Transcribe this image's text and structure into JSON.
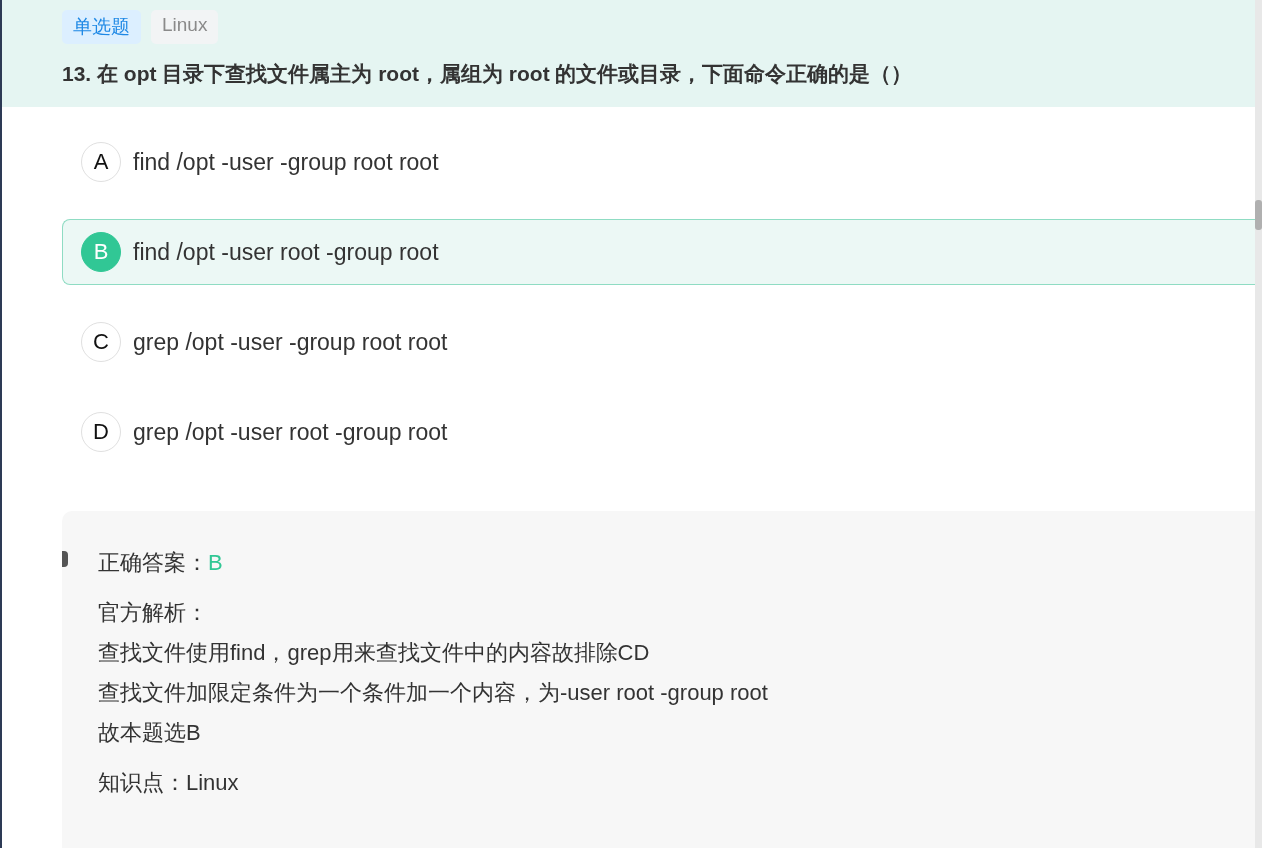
{
  "tags": [
    {
      "label": "单选题",
      "kind": "type"
    },
    {
      "label": "Linux",
      "kind": "topic"
    }
  ],
  "question": "13. 在 opt 目录下查找文件属主为 root，属组为 root 的文件或目录，下面命令正确的是（）",
  "options": [
    {
      "letter": "A",
      "text": "find /opt -user -group root root",
      "selected": false
    },
    {
      "letter": "B",
      "text": "find /opt -user root -group root",
      "selected": true
    },
    {
      "letter": "C",
      "text": "grep /opt -user -group root root",
      "selected": false
    },
    {
      "letter": "D",
      "text": "grep /opt -user root -group root",
      "selected": false
    }
  ],
  "answer": {
    "label": "正确答案：",
    "value": "B"
  },
  "analysis": {
    "title": "官方解析：",
    "lines": [
      "查找文件使用find，grep用来查找文件中的内容故排除CD",
      "查找文件加限定条件为一个条件加一个内容，为-user root -group root",
      "故本题选B"
    ]
  },
  "knowledge": "知识点：Linux"
}
